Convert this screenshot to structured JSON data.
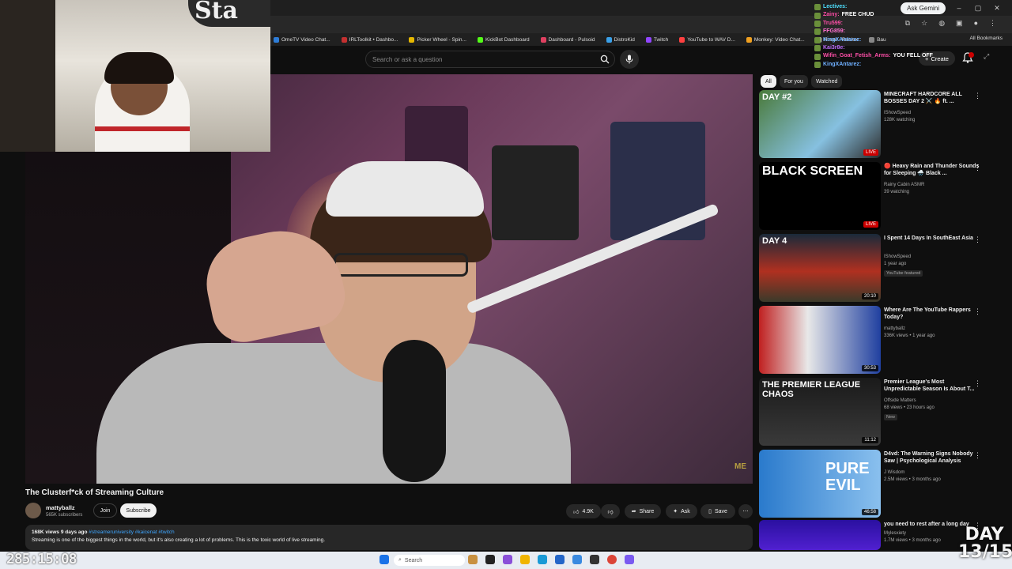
{
  "browser": {
    "ask_gemini": "Ask Gemini",
    "all_bookmarks": "All Bookmarks",
    "bookmarks": [
      {
        "label": "OmeTV Video Chat...",
        "color": "#2e7dd7"
      },
      {
        "label": "IRLToolkit • Dashbo...",
        "color": "#c43030"
      },
      {
        "label": "Picker Wheel - Spin...",
        "color": "#e6b800"
      },
      {
        "label": "KickBot Dashboard",
        "color": "#53fc18"
      },
      {
        "label": "Dashboard - Pulsoid",
        "color": "#e04060"
      },
      {
        "label": "DistroKid",
        "color": "#3aa0e8"
      },
      {
        "label": "Twitch",
        "color": "#9146ff"
      },
      {
        "label": "YouTube to WAV D...",
        "color": "#ff4040"
      },
      {
        "label": "Monkey: Video Chat...",
        "color": "#f0a020"
      },
      {
        "label": "Home - Roblox",
        "color": "#dddddd"
      },
      {
        "label": "Bau",
        "color": "#888888"
      }
    ]
  },
  "header": {
    "search_placeholder": "Search or ask a question",
    "create_label": "Create"
  },
  "video": {
    "title": "The Clusterf*ck of Streaming Culture",
    "channel_name": "mattyballz",
    "channel_subs": "565K subscribers",
    "join_label": "Join",
    "subscribe_label": "Subscribe",
    "like_count": "4.9K",
    "share_label": "Share",
    "ask_label": "Ask",
    "save_label": "Save",
    "watermark": "ME",
    "desc_meta": "168K views  9 days ago",
    "desc_tags": "#streameruniversity #kaicenat #twitch",
    "desc_text": "Streaming is one of the biggest things in the world, but it's also creating a lot of problems. This is the toxic world of live streaming."
  },
  "chips": [
    "All",
    "For you",
    "Watched"
  ],
  "recommendations": [
    {
      "title": "MINECRAFT HARDCORE ALL BOSSES DAY 2 ⚔️ 🔥 ft. ...",
      "channel": "IShowSpeed",
      "meta": "128K watching",
      "tag": "",
      "badge": "LIVE",
      "live": true,
      "thumb_text": "DAY #2",
      "thumb_bg": "linear-gradient(135deg,#4a7a3a,#86c0e0 60%,#2a2a2a)"
    },
    {
      "title": "🔴 Heavy Rain and Thunder Sounds for Sleeping 🌧️ Black ...",
      "channel": "Rainy Cabin ASMR",
      "meta": "39 watching",
      "tag": "",
      "badge": "LIVE",
      "live": true,
      "thumb_text": "BLACK SCREEN",
      "thumb_bg": "#000000"
    },
    {
      "title": "I Spent 14 Days In SouthEast Asia",
      "channel": "IShowSpeed",
      "meta": "1 year ago",
      "tag": "YouTube featured",
      "badge": "20:10",
      "live": false,
      "thumb_text": "DAY 4",
      "thumb_bg": "linear-gradient(180deg,#1a2a3a,#b03020 55%,#3a3a2a)"
    },
    {
      "title": "Where Are The YouTube Rappers Today?",
      "channel": "mattyballz",
      "meta": "336K views • 1 year ago",
      "tag": "",
      "badge": "30:53",
      "live": false,
      "thumb_text": "",
      "thumb_bg": "linear-gradient(90deg,#c02020,#e8e8e8 40%,#2040a0)"
    },
    {
      "title": "Premier League's Most Unpredictable Season Is About T...",
      "channel": "Offside Matters",
      "meta": "68 views • 23 hours ago",
      "tag": "New",
      "badge": "11:12",
      "live": false,
      "thumb_text": "THE PREMIER LEAGUE CHAOS",
      "thumb_bg": "linear-gradient(180deg,#1a1a1a,#3a3a3a)"
    },
    {
      "title": "D4vd: The Warning Signs Nobody Saw | Psychological Analysis",
      "channel": "J Wisdom",
      "meta": "2.5M views • 3 months ago",
      "tag": "",
      "badge": "46:58",
      "live": false,
      "thumb_text": "PURE EVIL",
      "thumb_bg": "linear-gradient(90deg,#2a7acc,#8ac0ee)"
    },
    {
      "title": "you need to rest after a long day",
      "channel": "Mylesxiety",
      "meta": "1.7M views • 3 months ago",
      "tag": "",
      "badge": "",
      "live": false,
      "thumb_text": "",
      "thumb_bg": "linear-gradient(180deg,#2a10a0,#5020d0)"
    }
  ],
  "chat": [
    {
      "user": "Lectives:",
      "msg": "",
      "color": "#4ee0ff"
    },
    {
      "user": "Zainy:",
      "msg": "FREE CHUD",
      "color": "#ff4fa8"
    },
    {
      "user": "Tru599:",
      "msg": "",
      "color": "#ff4fa8"
    },
    {
      "user": "FFG859:",
      "msg": "",
      "color": "#ff6fd0"
    },
    {
      "user": "KingXAntarez:",
      "msg": "",
      "color": "#6fb0ff"
    },
    {
      "user": "Kai3r8e:",
      "msg": "",
      "color": "#c070ff"
    },
    {
      "user": "Wifin_Goat_Fetish_Arms:",
      "msg": "YOU FELL OFF",
      "color": "#ff4fa8"
    },
    {
      "user": "KingXAntarez:",
      "msg": "",
      "color": "#6fb0ff"
    }
  ],
  "taskbar": {
    "search_label": "Search"
  },
  "overlay": {
    "timer": "285:15:08",
    "day_label": "DAY",
    "day_count": "13/15",
    "sign_text": "Sta"
  },
  "colors": {
    "accent": "#cc0000",
    "link": "#3ea6ff"
  }
}
